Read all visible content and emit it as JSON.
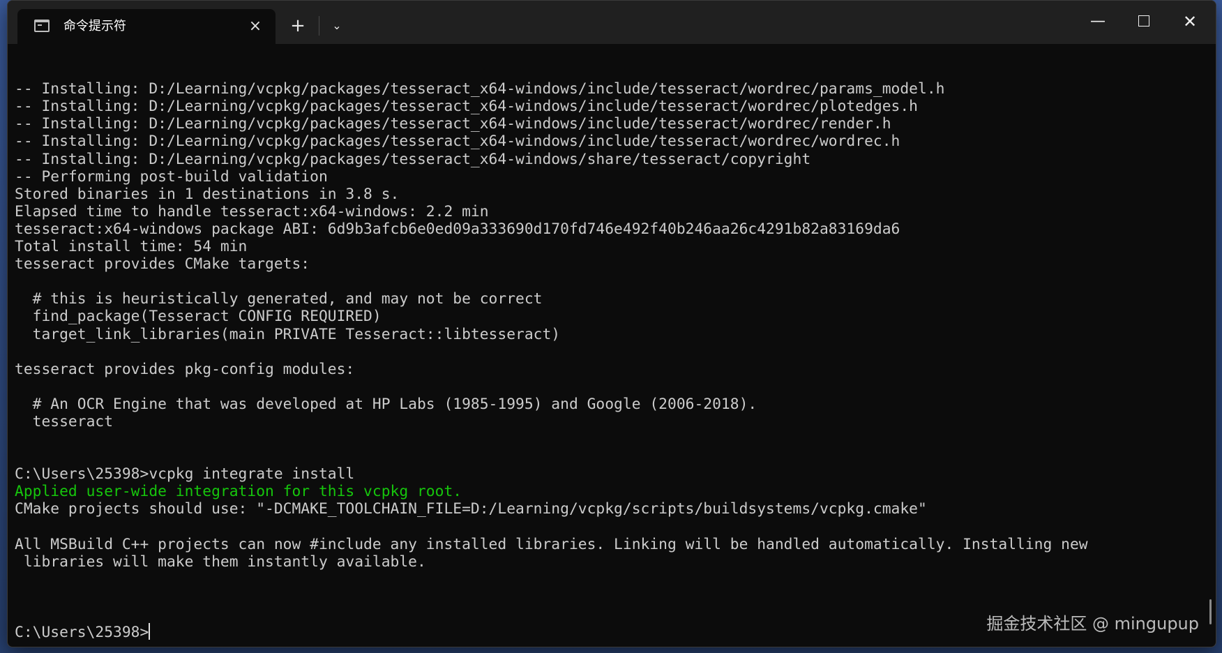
{
  "window": {
    "tab_title": "命令提示符",
    "tab_close_icon": "×",
    "new_tab_icon": "+",
    "dropdown_icon": "⌄",
    "minimize_icon": "—",
    "close_icon": "✕"
  },
  "console": {
    "lines": [
      {
        "text": "-- Installing: D:/Learning/vcpkg/packages/tesseract_x64-windows/include/tesseract/wordrec/params_model.h"
      },
      {
        "text": "-- Installing: D:/Learning/vcpkg/packages/tesseract_x64-windows/include/tesseract/wordrec/plotedges.h"
      },
      {
        "text": "-- Installing: D:/Learning/vcpkg/packages/tesseract_x64-windows/include/tesseract/wordrec/render.h"
      },
      {
        "text": "-- Installing: D:/Learning/vcpkg/packages/tesseract_x64-windows/include/tesseract/wordrec/wordrec.h"
      },
      {
        "text": "-- Installing: D:/Learning/vcpkg/packages/tesseract_x64-windows/share/tesseract/copyright"
      },
      {
        "text": "-- Performing post-build validation"
      },
      {
        "text": "Stored binaries in 1 destinations in 3.8 s."
      },
      {
        "text": "Elapsed time to handle tesseract:x64-windows: 2.2 min"
      },
      {
        "text": "tesseract:x64-windows package ABI: 6d9b3afcb6e0ed09a333690d170fd746e492f40b246aa26c4291b82a83169da6"
      },
      {
        "text": "Total install time: 54 min"
      },
      {
        "text": "tesseract provides CMake targets:"
      },
      {
        "text": ""
      },
      {
        "text": "  # this is heuristically generated, and may not be correct"
      },
      {
        "text": "  find_package(Tesseract CONFIG REQUIRED)"
      },
      {
        "text": "  target_link_libraries(main PRIVATE Tesseract::libtesseract)"
      },
      {
        "text": ""
      },
      {
        "text": "tesseract provides pkg-config modules:"
      },
      {
        "text": ""
      },
      {
        "text": "  # An OCR Engine that was developed at HP Labs (1985-1995) and Google (2006-2018)."
      },
      {
        "text": "  tesseract"
      },
      {
        "text": ""
      },
      {
        "text": ""
      },
      {
        "text": "C:\\Users\\25398>vcpkg integrate install"
      },
      {
        "text": "Applied user-wide integration for this vcpkg root.",
        "color": "#16c60c"
      },
      {
        "text": "CMake projects should use: \"-DCMAKE_TOOLCHAIN_FILE=D:/Learning/vcpkg/scripts/buildsystems/vcpkg.cmake\""
      },
      {
        "text": ""
      },
      {
        "text": "All MSBuild C++ projects can now #include any installed libraries. Linking will be handled automatically. Installing new"
      },
      {
        "text": " libraries will make them instantly available."
      },
      {
        "text": ""
      }
    ],
    "prompt": "C:\\Users\\25398>"
  },
  "watermark": "掘金技术社区 @ mingupup"
}
